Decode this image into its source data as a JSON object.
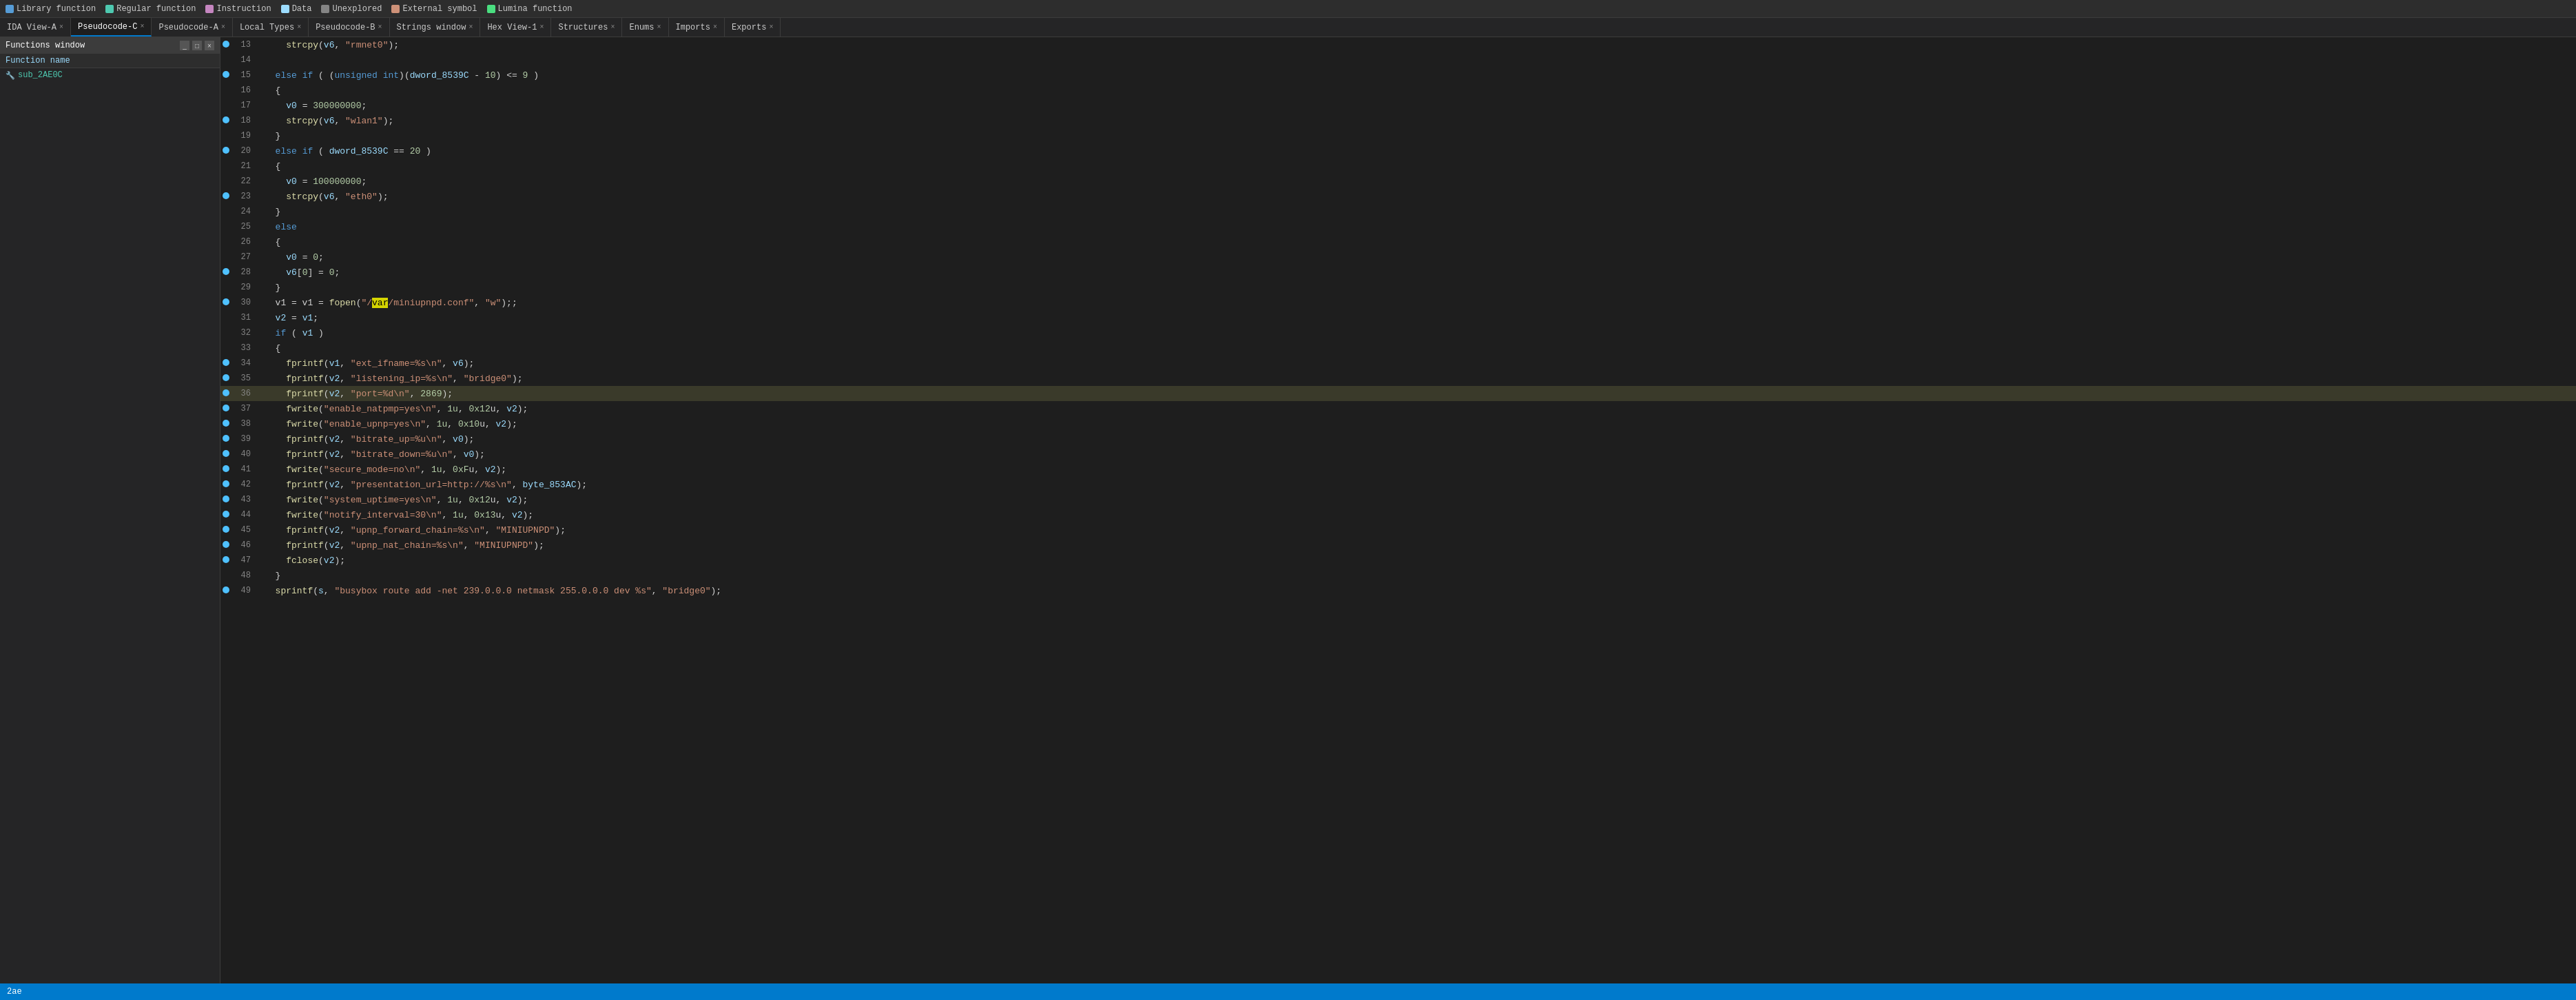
{
  "legend": [
    {
      "label": "Library function",
      "color": "#569cd6"
    },
    {
      "label": "Regular function",
      "color": "#4ec9b0"
    },
    {
      "label": "Instruction",
      "color": "#c586c0"
    },
    {
      "label": "Data",
      "color": "#9cdcfe"
    },
    {
      "label": "Unexplored",
      "color": "#858585"
    },
    {
      "label": "External symbol",
      "color": "#ce9178"
    },
    {
      "label": "Lumina function",
      "color": "#4ade80"
    }
  ],
  "tabs": [
    {
      "label": "IDA View-A",
      "active": false,
      "closeable": true
    },
    {
      "label": "Pseudocode-C",
      "active": true,
      "closeable": true
    },
    {
      "label": "Pseudocode-A",
      "active": false,
      "closeable": true
    },
    {
      "label": "Local Types",
      "active": false,
      "closeable": true
    },
    {
      "label": "Pseudocode-B",
      "active": false,
      "closeable": true
    },
    {
      "label": "Strings window",
      "active": false,
      "closeable": true
    },
    {
      "label": "Hex View-1",
      "active": false,
      "closeable": true
    },
    {
      "label": "Structures",
      "active": false,
      "closeable": true
    },
    {
      "label": "Enums",
      "active": false,
      "closeable": true
    },
    {
      "label": "Imports",
      "active": false,
      "closeable": true
    },
    {
      "label": "Exports",
      "active": false,
      "closeable": true
    }
  ],
  "sidebar": {
    "title": "Functions window",
    "header": "Function name",
    "items": [
      {
        "icon": "🔧",
        "name": "sub_2AE0C"
      }
    ]
  },
  "status": "2ae",
  "lines": [
    {
      "num": 13,
      "dot": true,
      "code": "    strcpy(v6, \"rmnet0\");"
    },
    {
      "num": 14,
      "dot": false,
      "code": ""
    },
    {
      "num": 15,
      "dot": true,
      "code": "  else if ( (unsigned int)(dword_8539C - 10) <= 9 )"
    },
    {
      "num": 16,
      "dot": false,
      "code": "  {"
    },
    {
      "num": 17,
      "dot": false,
      "code": "    v0 = 300000000;"
    },
    {
      "num": 18,
      "dot": true,
      "code": "    strcpy(v6, \"wlan1\");"
    },
    {
      "num": 19,
      "dot": false,
      "code": "  }"
    },
    {
      "num": 20,
      "dot": true,
      "code": "  else if ( dword_8539C == 20 )"
    },
    {
      "num": 21,
      "dot": false,
      "code": "  {"
    },
    {
      "num": 22,
      "dot": false,
      "code": "    v0 = 100000000;"
    },
    {
      "num": 23,
      "dot": true,
      "code": "    strcpy(v6, \"eth0\");"
    },
    {
      "num": 24,
      "dot": false,
      "code": "  }"
    },
    {
      "num": 25,
      "dot": false,
      "code": "  else"
    },
    {
      "num": 26,
      "dot": false,
      "code": "  {"
    },
    {
      "num": 27,
      "dot": false,
      "code": "    v0 = 0;"
    },
    {
      "num": 28,
      "dot": true,
      "code": "    v6[0] = 0;"
    },
    {
      "num": 29,
      "dot": false,
      "code": "  }"
    },
    {
      "num": 30,
      "dot": true,
      "code": "  v1 = fopen(\"/var/miniupnpd.conf\", \"w\");"
    },
    {
      "num": 31,
      "dot": false,
      "code": "  v2 = v1;"
    },
    {
      "num": 32,
      "dot": false,
      "code": "  if ( v1 )"
    },
    {
      "num": 33,
      "dot": false,
      "code": "  {"
    },
    {
      "num": 34,
      "dot": true,
      "code": "    fprintf(v1, \"ext_ifname=%s\\n\", v6);"
    },
    {
      "num": 35,
      "dot": true,
      "code": "    fprintf(v2, \"listening_ip=%s\\n\", \"bridge0\");"
    },
    {
      "num": 36,
      "dot": true,
      "code": "    fprintf(v2, \"port=%d\\n\", 2869);",
      "highlighted": true
    },
    {
      "num": 37,
      "dot": true,
      "code": "    fwrite(\"enable_natpmp=yes\\n\", 1u, 0x12u, v2);"
    },
    {
      "num": 38,
      "dot": true,
      "code": "    fwrite(\"enable_upnp=yes\\n\", 1u, 0x10u, v2);"
    },
    {
      "num": 39,
      "dot": true,
      "code": "    fprintf(v2, \"bitrate_up=%u\\n\", v0);"
    },
    {
      "num": 40,
      "dot": true,
      "code": "    fprintf(v2, \"bitrate_down=%u\\n\", v0);"
    },
    {
      "num": 41,
      "dot": true,
      "code": "    fwrite(\"secure_mode=no\\n\", 1u, 0xFu, v2);"
    },
    {
      "num": 42,
      "dot": true,
      "code": "    fprintf(v2, \"presentation_url=http://%s\\n\", byte_853AC);"
    },
    {
      "num": 43,
      "dot": true,
      "code": "    fwrite(\"system_uptime=yes\\n\", 1u, 0x12u, v2);"
    },
    {
      "num": 44,
      "dot": true,
      "code": "    fwrite(\"notify_interval=30\\n\", 1u, 0x13u, v2);"
    },
    {
      "num": 45,
      "dot": true,
      "code": "    fprintf(v2, \"upnp_forward_chain=%s\\n\", \"MINIUPNPD\");"
    },
    {
      "num": 46,
      "dot": true,
      "code": "    fprintf(v2, \"upnp_nat_chain=%s\\n\", \"MINIUPNPD\");"
    },
    {
      "num": 47,
      "dot": true,
      "code": "    fclose(v2);"
    },
    {
      "num": 48,
      "dot": false,
      "code": "  }"
    },
    {
      "num": 49,
      "dot": true,
      "code": "  sprintf(s, \"busybox route add -net 239.0.0.0 netmask 255.0.0.0 dev %s\", \"bridge0\");"
    }
  ]
}
